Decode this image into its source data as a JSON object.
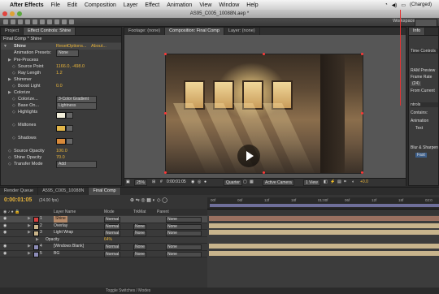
{
  "menubar": {
    "app": "After Effects",
    "items": [
      "File",
      "Edit",
      "Composition",
      "Layer",
      "Effect",
      "Animation",
      "View",
      "Window",
      "Help"
    ],
    "battery": "(Charged)"
  },
  "window": {
    "title": "AS95_C005_10088N.aep *"
  },
  "toolbar": {
    "workspace_label": "Workspace:"
  },
  "left_panel": {
    "tabs": [
      "Project",
      "Effect Controls: Shine"
    ],
    "comp_path": "Final Comp * Shine",
    "effect": {
      "name": "Shine",
      "reset": "Reset",
      "options": "Options...",
      "about": "About...",
      "animation_presets_label": "Animation Presets:",
      "animation_presets_value": "None",
      "rows": [
        {
          "label": "Pre-Process",
          "value": ""
        },
        {
          "label": "Source Point",
          "value": "1166.0, -498.0"
        },
        {
          "label": "Ray Length",
          "value": "1.2"
        },
        {
          "label": "Shimmer",
          "value": ""
        },
        {
          "label": "Boost Light",
          "value": "0.0"
        },
        {
          "label": "Colorize",
          "value": ""
        },
        {
          "label": "Colorize...",
          "value": "3-Color Gradient"
        },
        {
          "label": "Base On...",
          "value": "Lightness"
        },
        {
          "label": "Highlights",
          "value": ""
        },
        {
          "label": "Midtones",
          "value": ""
        },
        {
          "label": "Shadows",
          "value": ""
        },
        {
          "label": "Source Opacity",
          "value": "100.0"
        },
        {
          "label": "Shine Opacity",
          "value": "70.0"
        },
        {
          "label": "Transfer Mode",
          "value": "Add"
        }
      ],
      "swatch_colors": {
        "highlights": "#f4f0dc",
        "midtones": "#e2b64a",
        "shadows": "#d98a3a"
      }
    }
  },
  "comp_panel": {
    "tabs": [
      "Footage: (none)",
      "Composition: Final Comp",
      "Layer: (none)"
    ],
    "bottom": {
      "zoom": "25%",
      "timecode": "0:00:01:05",
      "resolution": "Quarter",
      "camera": "Active Camera",
      "views": "1 View",
      "exposure": "+0.0"
    }
  },
  "right_panel": {
    "tab_info": "Info",
    "tab_time": "Time Controls",
    "ram_preview": "RAM Preview",
    "frame_rate_label": "Frame Rate",
    "frame_rate_value": "(24)",
    "from_current": "From Current",
    "effects_label": "ntrols",
    "contains": "Contains:",
    "animation": "Animation",
    "text": "Text",
    "blur": "Blur & Sharpen",
    "fast": "Fast"
  },
  "timeline": {
    "tabs": [
      "Render Queue",
      "A595_C005_10088N",
      "Final Comp"
    ],
    "timecode": "0:00:01:05",
    "fps": "(24.00 fps)",
    "columns": {
      "layer_name": "Layer Name",
      "mode": "Mode",
      "trkmat": "TrkMat",
      "parent": "Parent"
    },
    "layers": [
      {
        "num": "1",
        "name": "Shine",
        "mode": "Normal",
        "trkmat": "",
        "parent": "None",
        "label_color": "#d54040",
        "selected": true
      },
      {
        "num": "2",
        "name": "Overlay",
        "mode": "Normal",
        "trkmat": "None",
        "parent": "None",
        "label_color": "#c9b48a",
        "selected": false
      },
      {
        "num": "3",
        "name": "Light Wrap",
        "mode": "Normal",
        "trkmat": "None",
        "parent": "None",
        "label_color": "#c9b48a",
        "selected": false
      },
      {
        "num": "",
        "name": "Opacity",
        "mode": "64%",
        "trkmat": "",
        "parent": "",
        "label_color": "",
        "selected": false
      },
      {
        "num": "4",
        "name": "[Windows Blank]",
        "mode": "Normal",
        "trkmat": "None",
        "parent": "None",
        "label_color": "#8d8db8",
        "selected": false
      },
      {
        "num": "5",
        "name": "BG",
        "mode": "Normal",
        "trkmat": "None",
        "parent": "None",
        "label_color": "#8d8db8",
        "selected": false
      }
    ],
    "ruler_ticks": [
      "00f",
      "06f",
      "12f",
      "18f",
      "01:00f",
      "06f",
      "12f",
      "18f",
      "02:0"
    ],
    "status": "Toggle Switches / Modes",
    "colors": {
      "selected_bar": "#9a7060",
      "track_bar": "#c8b48c",
      "blank_bar": "#8a8ab6",
      "playhead": "#e33333"
    }
  },
  "colors": {
    "accent_value": "#e8b43a",
    "panel_bg": "#3b3b3b"
  }
}
